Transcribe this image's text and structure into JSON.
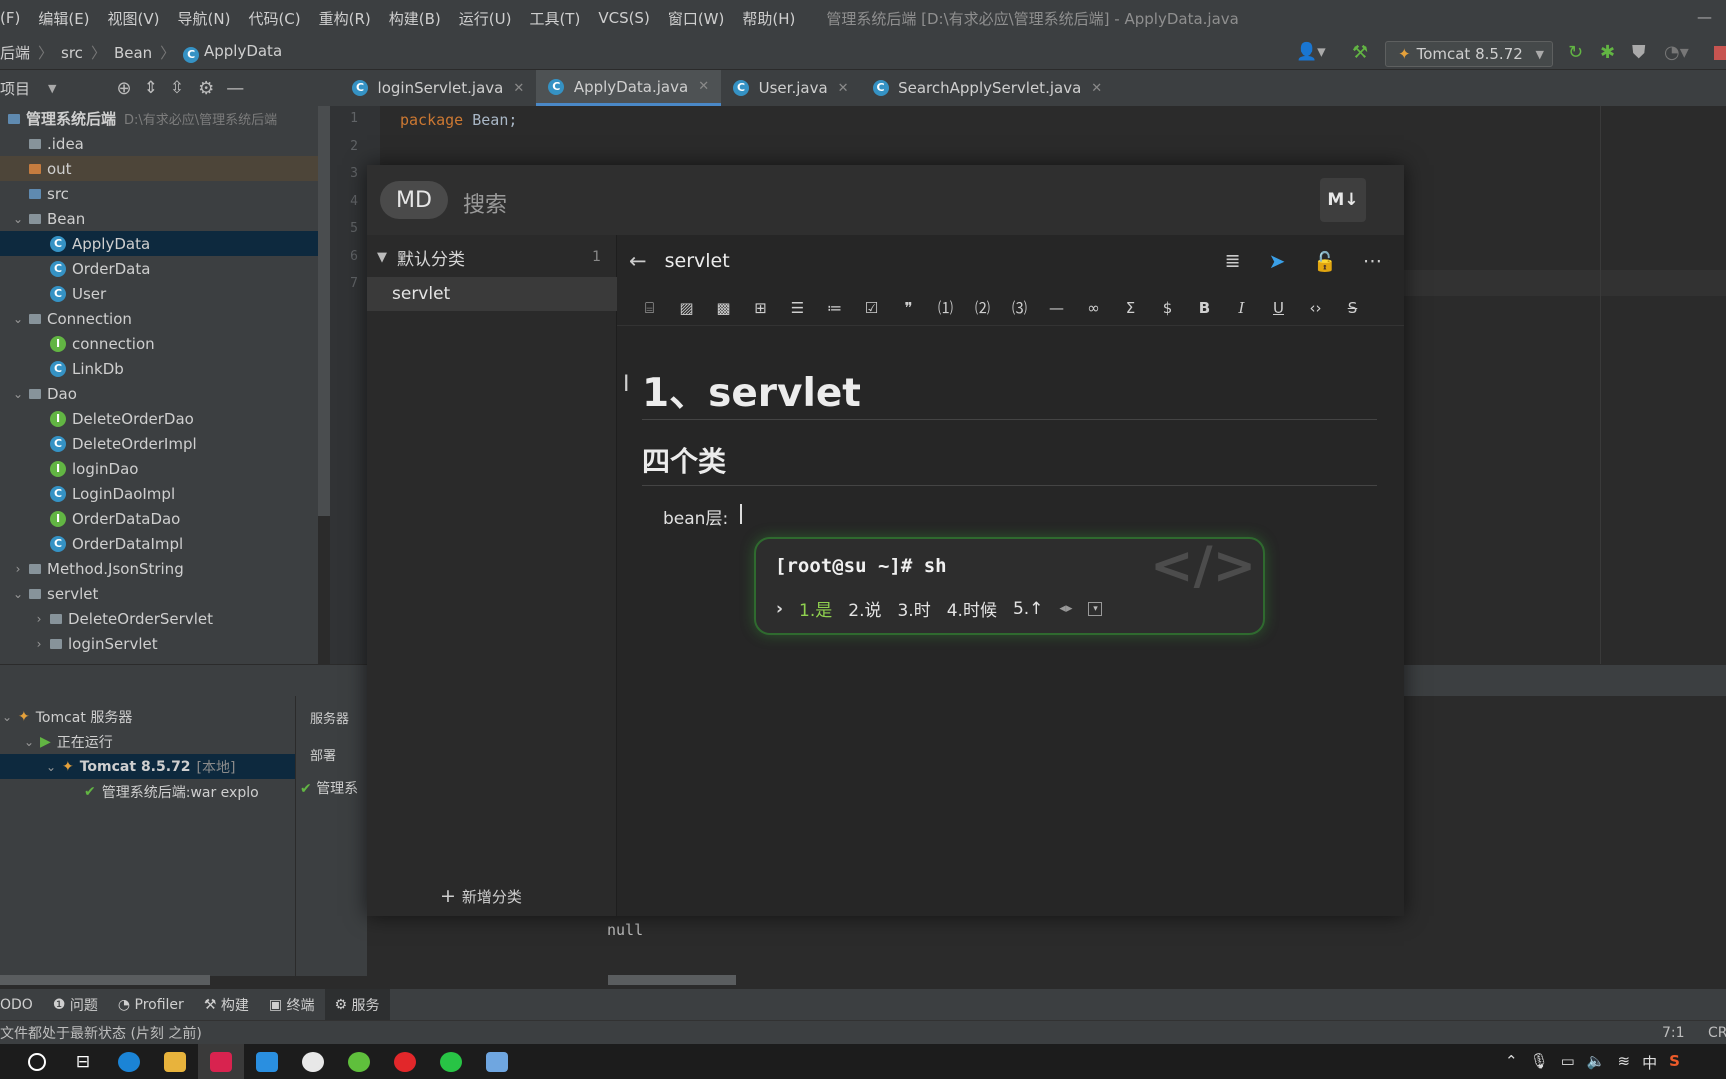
{
  "menu": {
    "items": [
      "(F)",
      "编辑(E)",
      "视图(V)",
      "导航(N)",
      "代码(C)",
      "重构(R)",
      "构建(B)",
      "运行(U)",
      "工具(T)",
      "VCS(S)",
      "窗口(W)",
      "帮助(H)"
    ],
    "window_title": "管理系统后端 [D:\\有求必应\\管理系统后端] - ApplyData.java"
  },
  "nav": {
    "crumbs": [
      "后端",
      "src",
      "Bean",
      "ApplyData"
    ],
    "run_config": "Tomcat 8.5.72"
  },
  "project": {
    "header": "项目",
    "tree": [
      {
        "label": "管理系统后端",
        "hint": "D:\\有求必应\\管理系统后端",
        "type": "root",
        "indent": 0
      },
      {
        "label": ".idea",
        "type": "folder",
        "indent": 1
      },
      {
        "label": "out",
        "type": "folder-orange",
        "indent": 1
      },
      {
        "label": "src",
        "type": "folder-blue",
        "indent": 1
      },
      {
        "label": "Bean",
        "type": "folder",
        "indent": 1,
        "open": true
      },
      {
        "label": "ApplyData",
        "type": "class",
        "indent": 2,
        "selected": true
      },
      {
        "label": "OrderData",
        "type": "class",
        "indent": 2
      },
      {
        "label": "User",
        "type": "class",
        "indent": 2
      },
      {
        "label": "Connection",
        "type": "folder",
        "indent": 1,
        "open": true
      },
      {
        "label": "connection",
        "type": "interface",
        "indent": 2
      },
      {
        "label": "LinkDb",
        "type": "class",
        "indent": 2
      },
      {
        "label": "Dao",
        "type": "folder",
        "indent": 1,
        "open": true
      },
      {
        "label": "DeleteOrderDao",
        "type": "interface",
        "indent": 2
      },
      {
        "label": "DeleteOrderImpl",
        "type": "class",
        "indent": 2
      },
      {
        "label": "loginDao",
        "type": "interface",
        "indent": 2
      },
      {
        "label": "LoginDaoImpl",
        "type": "class",
        "indent": 2
      },
      {
        "label": "OrderDataDao",
        "type": "interface",
        "indent": 2
      },
      {
        "label": "OrderDataImpl",
        "type": "class",
        "indent": 2
      },
      {
        "label": "Method.JsonString",
        "type": "folder",
        "indent": 1,
        "open": false
      },
      {
        "label": "servlet",
        "type": "folder",
        "indent": 1,
        "open": true
      },
      {
        "label": "DeleteOrderServlet",
        "type": "folder",
        "indent": 2,
        "open": false
      },
      {
        "label": "loginServlet",
        "type": "folder",
        "indent": 2,
        "open": false
      }
    ]
  },
  "editor": {
    "tabs": [
      {
        "label": "loginServlet.java",
        "active": false
      },
      {
        "label": "ApplyData.java",
        "active": true
      },
      {
        "label": "User.java",
        "active": false
      },
      {
        "label": "SearchApplyServlet.java",
        "active": false
      }
    ],
    "line_numbers": [
      "1",
      "2",
      "3",
      "4",
      "5",
      "6",
      "7"
    ],
    "code_keyword": "package",
    "code_rest": " Bean;"
  },
  "services": {
    "tree": [
      {
        "label": "Tomcat 服务器",
        "indent": 0
      },
      {
        "label": "正在运行",
        "indent": 1
      },
      {
        "label": "Tomcat 8.5.72",
        "suffix": "[本地]",
        "indent": 2,
        "selected": true
      },
      {
        "label": "管理系统后端:war explo",
        "indent": 3
      }
    ],
    "side_tabs": [
      "服务器",
      "部署"
    ],
    "deploy_item": "管理系",
    "output": "null"
  },
  "bottom_tabs": [
    "ODO",
    "问题",
    "Profiler",
    "构建",
    "终端",
    "服务"
  ],
  "status": {
    "message": "文件都处于最新状态 (片刻 之前)",
    "position": "7:1",
    "encoding": "CR"
  },
  "note_app": {
    "badge": "MD",
    "search_placeholder": "搜索",
    "md_button": "M↓",
    "category": "默认分类",
    "category_count": "1",
    "note_item": "servlet",
    "add_category": "新增分类",
    "doc_title": "servlet",
    "h1": "1、servlet",
    "h2": "四个类",
    "paragraph": "bean层:"
  },
  "ime": {
    "input": "[root@su ~]# sh",
    "candidates": [
      "1.是",
      "2.说",
      "3.时",
      "4.时候",
      "5.↑"
    ]
  },
  "colors": {
    "accent": "#4a88c7",
    "ime_border": "#2f6a2f",
    "ime_highlight": "#8fd14f"
  }
}
